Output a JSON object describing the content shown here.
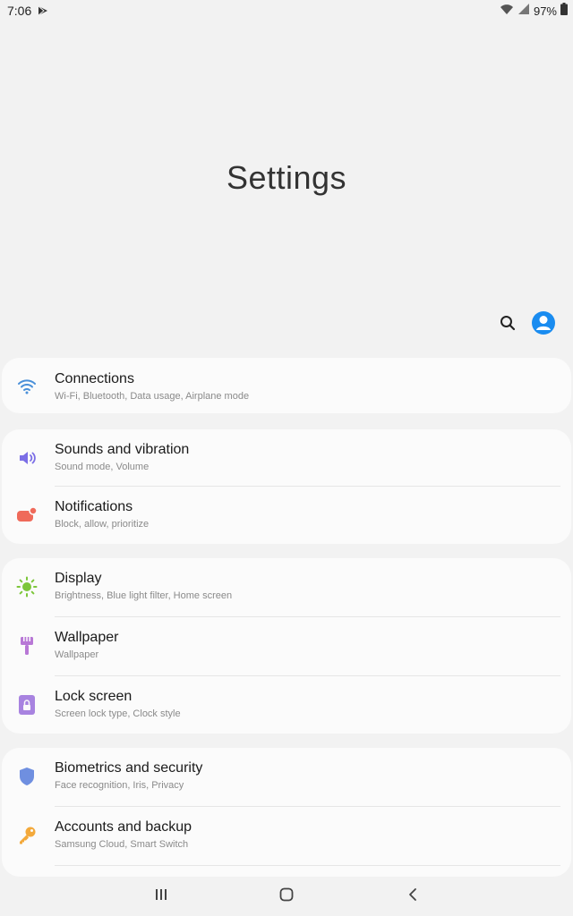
{
  "status_bar": {
    "time": "7:06",
    "battery": "97%",
    "icons": [
      "play-store-notification-icon",
      "wifi-icon",
      "signal-icon",
      "battery-icon"
    ]
  },
  "title": "Settings",
  "header": {
    "icons": [
      "search-icon",
      "profile-icon"
    ],
    "accent_color": "#1a8cf0"
  },
  "groups": [
    {
      "items": [
        {
          "title": "Connections",
          "subtitle": "Wi-Fi, Bluetooth, Data usage, Airplane mode",
          "icon": "wifi-icon",
          "color": "#4a90d9"
        }
      ]
    },
    {
      "items": [
        {
          "title": "Sounds and vibration",
          "subtitle": "Sound mode, Volume",
          "icon": "speaker-icon",
          "color": "#7b6ee6"
        },
        {
          "title": "Notifications",
          "subtitle": "Block, allow, prioritize",
          "icon": "notification-icon",
          "color": "#ef6a5a"
        }
      ]
    },
    {
      "items": [
        {
          "title": "Display",
          "subtitle": "Brightness, Blue light filter, Home screen",
          "icon": "sun-icon",
          "color": "#7cc63a"
        },
        {
          "title": "Wallpaper",
          "subtitle": "Wallpaper",
          "icon": "paintbrush-icon",
          "color": "#b878d6"
        },
        {
          "title": "Lock screen",
          "subtitle": "Screen lock type, Clock style",
          "icon": "lock-icon",
          "color": "#a883e0"
        }
      ]
    },
    {
      "items": [
        {
          "title": "Biometrics and security",
          "subtitle": "Face recognition, Iris, Privacy",
          "icon": "shield-icon",
          "color": "#6f8fe0"
        },
        {
          "title": "Accounts and backup",
          "subtitle": "Samsung Cloud, Smart Switch",
          "icon": "key-icon",
          "color": "#f3a93b"
        }
      ]
    }
  ],
  "nav_bar": {
    "icons": [
      "recent-apps-icon",
      "home-icon",
      "back-icon"
    ]
  }
}
